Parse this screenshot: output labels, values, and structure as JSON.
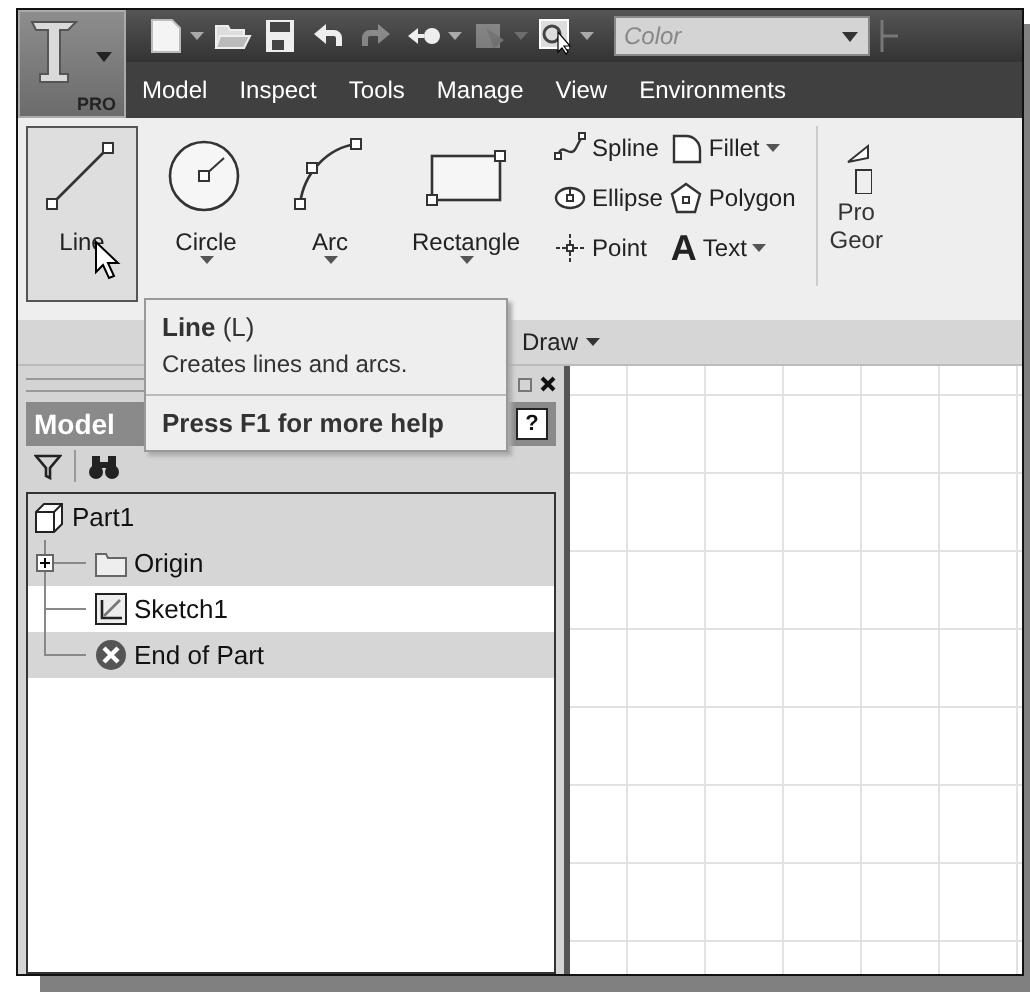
{
  "app_button": {
    "badge": "PRO"
  },
  "quick_access": [
    {
      "kind": "new",
      "dropdown": true,
      "disabled": false
    },
    {
      "kind": "open",
      "dropdown": false,
      "disabled": false
    },
    {
      "kind": "save",
      "dropdown": false,
      "disabled": false
    },
    {
      "kind": "undo",
      "dropdown": false,
      "disabled": false
    },
    {
      "kind": "redo",
      "dropdown": false,
      "disabled": true
    },
    {
      "kind": "return",
      "dropdown": true,
      "disabled": false
    },
    {
      "kind": "update",
      "dropdown": true,
      "disabled": true
    },
    {
      "kind": "select",
      "dropdown": true,
      "disabled": false
    }
  ],
  "color_combo": {
    "placeholder": "Color"
  },
  "tabs": [
    {
      "label": "Model",
      "selected": false
    },
    {
      "label": "Inspect",
      "selected": false
    },
    {
      "label": "Tools",
      "selected": false
    },
    {
      "label": "Manage",
      "selected": false
    },
    {
      "label": "View",
      "selected": false
    },
    {
      "label": "Environments",
      "selected": false
    }
  ],
  "ribbon": {
    "large_tools": [
      {
        "kind": "line",
        "label": "Line",
        "dropdown": false,
        "highlighted": true
      },
      {
        "kind": "circle",
        "label": "Circle",
        "dropdown": true,
        "highlighted": false
      },
      {
        "kind": "arc",
        "label": "Arc",
        "dropdown": true,
        "highlighted": false
      },
      {
        "kind": "rectangle",
        "label": "Rectangle",
        "dropdown": true,
        "highlighted": false
      }
    ],
    "small_tools": [
      {
        "kind": "spline",
        "label": "Spline",
        "dropdown": false
      },
      {
        "kind": "ellipse",
        "label": "Ellipse",
        "dropdown": false
      },
      {
        "kind": "point",
        "label": "Point",
        "dropdown": false
      },
      {
        "kind": "fillet",
        "label": "Fillet",
        "dropdown": true
      },
      {
        "kind": "polygon",
        "label": "Polygon",
        "dropdown": false
      },
      {
        "kind": "text",
        "label": "Text",
        "dropdown": true,
        "glyph": "A"
      }
    ],
    "cut_tool": {
      "lines": [
        "Pro",
        "Geor"
      ]
    },
    "panel_label": "Draw"
  },
  "tooltip": {
    "title": "**Line** (L)",
    "description": "Creates lines and arcs.",
    "help": "Press F1 for more help"
  },
  "browser": {
    "title": "Model",
    "help_glyph": "?",
    "tree": [
      {
        "kind": "part",
        "label": "Part1",
        "selected": true,
        "children": [
          {
            "kind": "folder",
            "label": "Origin",
            "selected": true,
            "expanded": false
          },
          {
            "kind": "sketch",
            "label": "Sketch1",
            "selected": false
          },
          {
            "kind": "end",
            "label": "End of Part",
            "selected": true
          }
        ]
      }
    ]
  }
}
